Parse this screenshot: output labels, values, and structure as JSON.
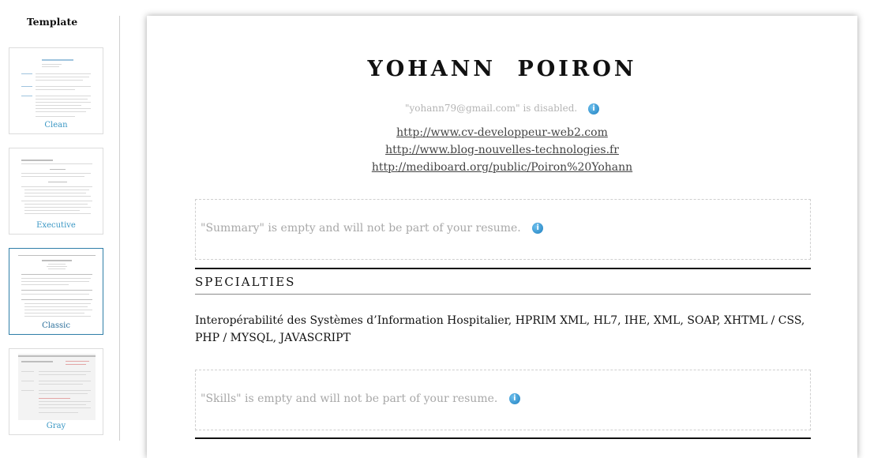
{
  "sidebar": {
    "title": "Template",
    "templates": [
      {
        "label": "Clean",
        "selected": false
      },
      {
        "label": "Executive",
        "selected": false
      },
      {
        "label": "Classic",
        "selected": true
      },
      {
        "label": "Gray",
        "selected": false
      }
    ]
  },
  "resume": {
    "name": "YOHANN POIRON",
    "email_notice": "\"yohann79@gmail.com\" is disabled.",
    "links": [
      "http://www.cv-developpeur-web2.com",
      "http://www.blog-nouvelles-technologies.fr",
      "http://mediboard.org/public/Poiron%20Yohann"
    ],
    "summary_empty": "\"Summary\" is empty and will not be part of your resume.",
    "specialties": {
      "title": "SPECIALTIES",
      "text": "Interopérabilité des Systèmes d’Information Hospitalier, HPRIM XML, HL7, IHE, XML, SOAP, XHTML / CSS, PHP / MYSQL, JAVASCRIPT"
    },
    "skills_empty": "\"Skills\" is empty and will not be part of your resume."
  },
  "icons": {
    "info": "info-icon"
  },
  "colors": {
    "accent_blue": "#3a97c4",
    "selected_border": "#2f7ea8",
    "info_icon": "#1f7fbf"
  }
}
